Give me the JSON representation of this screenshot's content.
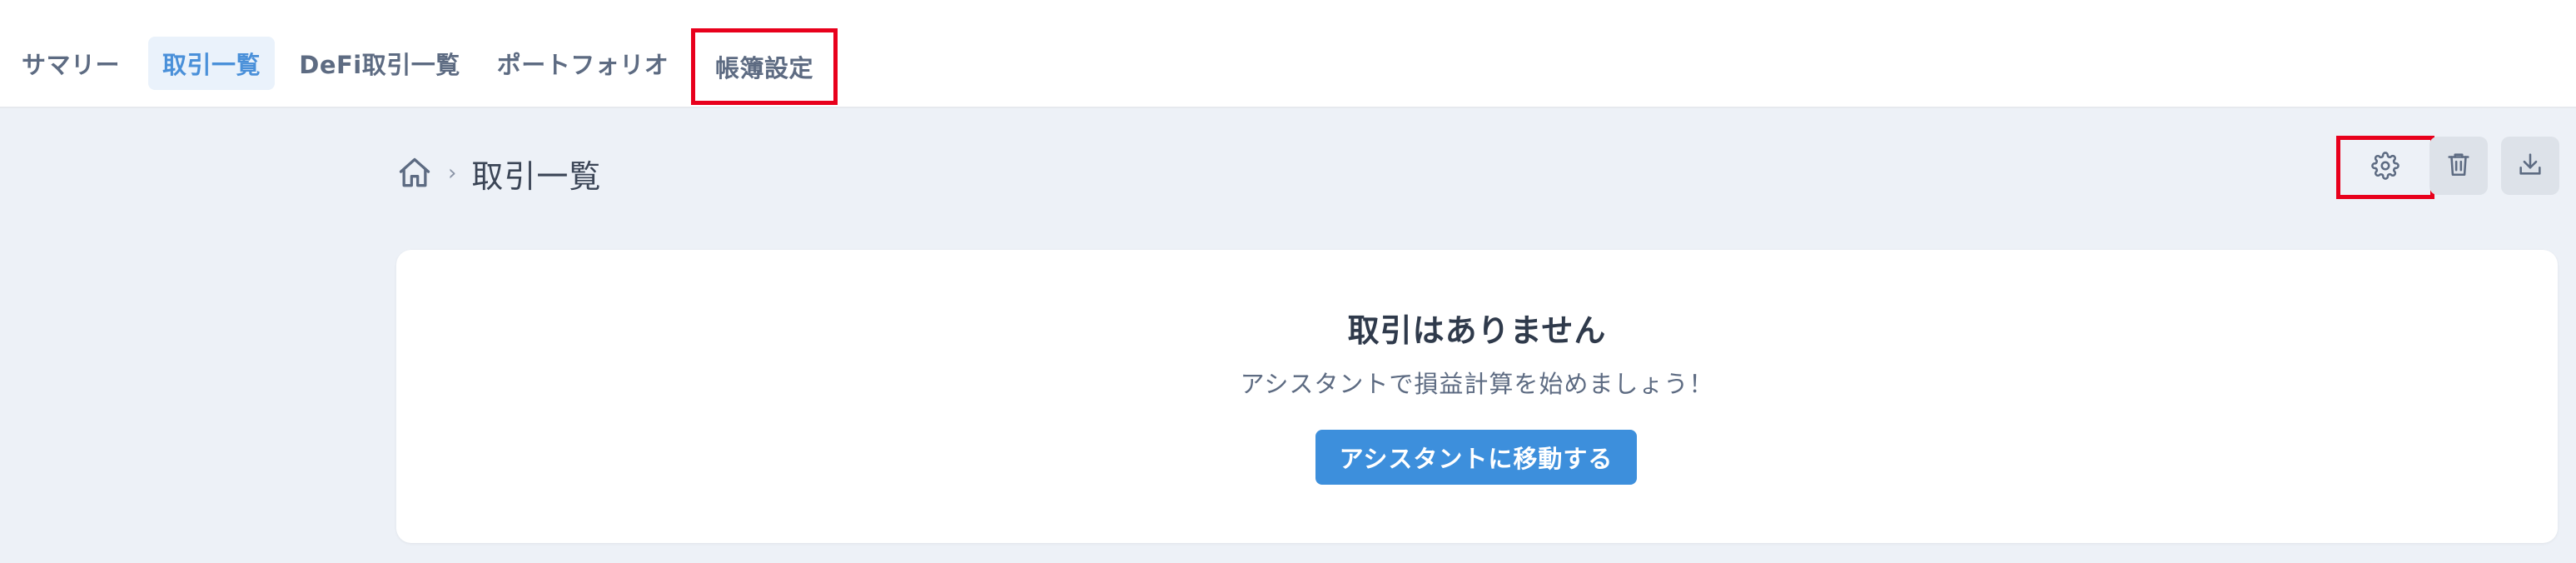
{
  "nav": {
    "tabs": [
      {
        "label": "サマリー",
        "active": false
      },
      {
        "label": "取引一覧",
        "active": true
      },
      {
        "label": "DeFi取引一覧",
        "active": false
      },
      {
        "label": "ポートフォリオ",
        "active": false
      },
      {
        "label": "帳簿設定",
        "active": false,
        "highlighted": true
      }
    ]
  },
  "breadcrumb": {
    "home_icon": "home-icon",
    "separator": "›",
    "current": "取引一覧"
  },
  "actions": [
    {
      "name": "settings-button",
      "icon": "gear-icon",
      "highlighted": true
    },
    {
      "name": "delete-button",
      "icon": "trash-icon"
    },
    {
      "name": "download-button",
      "icon": "download-icon"
    }
  ],
  "empty_state": {
    "title": "取引はありません",
    "subtitle": "アシスタントで損益計算を始めましょう！",
    "button_label": "アシスタントに移動する"
  },
  "colors": {
    "accent": "#3d8fdc",
    "highlight_border": "#e8001c",
    "background": "#edf1f7"
  }
}
